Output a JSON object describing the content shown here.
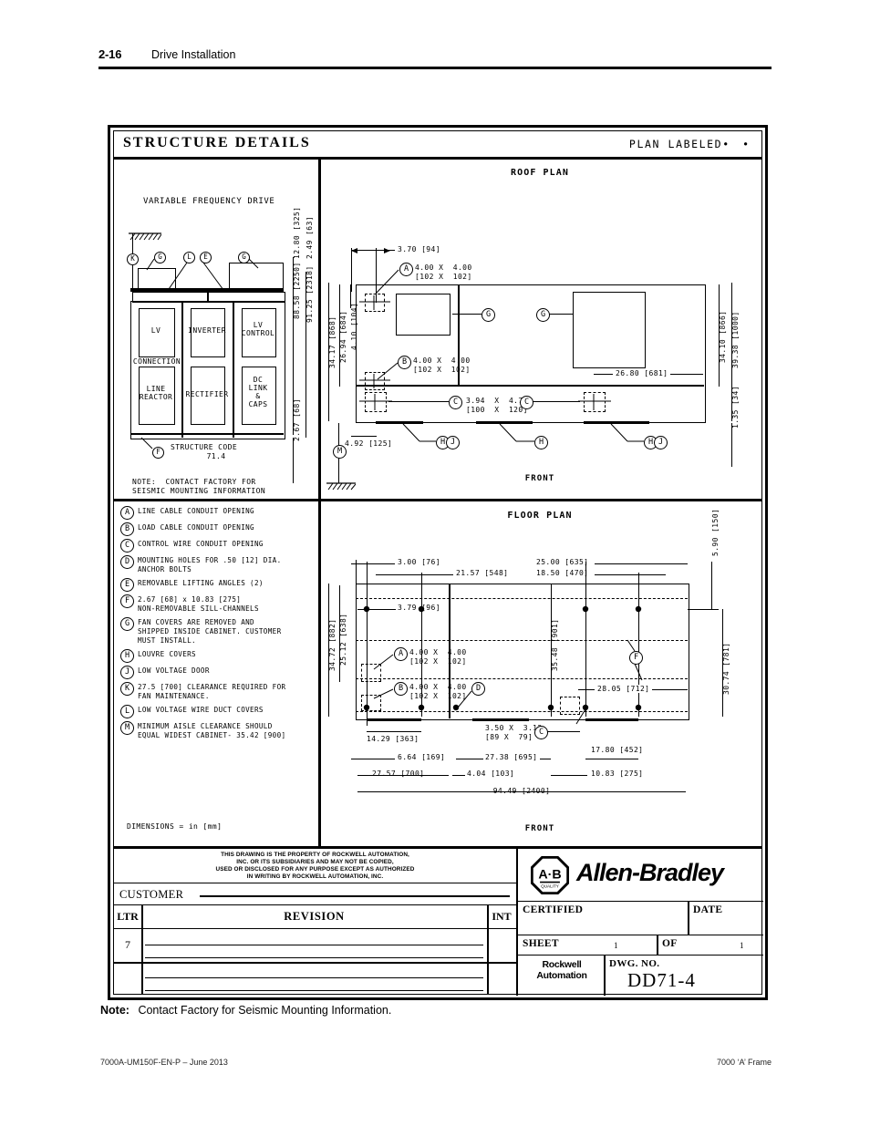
{
  "page_header": {
    "page_number": "2-16",
    "section_title": "Drive Installation"
  },
  "drawing": {
    "title": "STRUCTURE  DETAILS",
    "plan_labeled": "PLAN LABELED",
    "plan_labeled_dots": "•   •",
    "dimensions_note": "DIMENSIONS = in [mm]"
  },
  "elevation": {
    "caption": "VARIABLE FREQUENCY DRIVE",
    "structure_code_label": "STRUCTURE CODE",
    "structure_code_value": "71.4",
    "note_line1": "NOTE:  CONTACT FACTORY FOR",
    "note_line2": "SEISMIC MOUNTING INFORMATION",
    "compartments": [
      "LV",
      "INVERTER",
      "LV\nCONTROL",
      "CONNECTION",
      "LINE\nREACTOR",
      "RECTIFIER",
      "DC\nLINK\n&\nCAPS"
    ],
    "cell_lv": "LV",
    "cell_inverter": "INVERTER",
    "cell_lvcontrol": "LV\nCONTROL",
    "cell_connection": "CONNECTION",
    "cell_linereactor": "LINE\nREACTOR",
    "cell_rectifier": "RECTIFIER",
    "cell_dclink": "DC\nLINK\n&\nCAPS",
    "dims": {
      "d_12_80": "12.80 [325]",
      "d_2_49": "2.49 [63]",
      "d_88_58": "88.58 [2250]",
      "d_91_25": "91.25 [2318]",
      "d_2_67": "2.67 [68]"
    },
    "balloons": [
      "K",
      "G",
      "L",
      "E",
      "G",
      "F"
    ]
  },
  "roof_plan": {
    "title": "ROOF PLAN",
    "front_label": "FRONT",
    "dims": {
      "d_3_70": "3.70 [94]",
      "a_size": "4.00 X  4.00",
      "a_size_mm": "[102 X  102]",
      "b_size": "4.00 X  4.00",
      "b_size_mm": "[102 X  102]",
      "c_size": "3.94  X  4.73",
      "c_size_mm": "[100  X  120]",
      "d_34_17": "34.17 [868]",
      "d_26_94": "26.94 [684]",
      "d_4_10": "4.10 [104]",
      "d_4_92": "4.92 [125]",
      "d_26_80": "26.80 [681]",
      "d_34_10": "34.10 [866]",
      "d_39_38": "39.38 [1000]",
      "d_1_35": "1.35 [34]"
    },
    "balloons": [
      "A",
      "B",
      "C",
      "C",
      "G",
      "G",
      "H",
      "J",
      "H",
      "H",
      "J",
      "M"
    ]
  },
  "floor_plan": {
    "title": "FLOOR PLAN",
    "front_label": "FRONT",
    "dims": {
      "d_3_00": "3.00 [76]",
      "d_21_57": "21.57 [548]",
      "d_25_00": "25.00 [635]",
      "d_18_50": "18.50 [470]",
      "d_5_90": "5.90 [150]",
      "d_3_79": "3.79 [96]",
      "d_34_72": "34.72 [882]",
      "d_25_12": "25.12 [638]",
      "d_35_48": "35.48 [901]",
      "d_30_74": "30.74 [781]",
      "d_28_05": "28.05 [712]",
      "a_size": "4.00 X  4.00",
      "a_size_mm": "[102 X  102]",
      "b_size": "4.00 X  4.00",
      "b_size_mm": "[102 X  102]",
      "c_size": "3.50 X  3.12",
      "c_size_mm": "[89 X  79]",
      "d_14_29": "14.29 [363]",
      "d_6_64": "6.64 [169]",
      "d_27_38": "27.38 [695]",
      "d_17_80": "17.80 [452]",
      "d_27_57": "27.57 [700]",
      "d_4_04": "4.04 [103]",
      "d_10_83": "10.83 [275]",
      "d_94_49": "94.49 [2400]"
    },
    "balloons": [
      "A",
      "B",
      "C",
      "D",
      "F"
    ]
  },
  "legend": [
    {
      "letter": "A",
      "text": "LINE CABLE CONDUIT OPENING"
    },
    {
      "letter": "B",
      "text": "LOAD CABLE CONDUIT OPENING"
    },
    {
      "letter": "C",
      "text": "CONTROL WIRE CONDUIT OPENING"
    },
    {
      "letter": "D",
      "text": "MOUNTING HOLES FOR .50 [12] DIA.\nANCHOR BOLTS"
    },
    {
      "letter": "E",
      "text": "REMOVABLE LIFTING ANGLES (2)"
    },
    {
      "letter": "F",
      "text": "2.67 [68] x 10.83 [275]\nNON-REMOVABLE SILL-CHANNELS"
    },
    {
      "letter": "G",
      "text": "FAN COVERS ARE REMOVED AND\nSHIPPED INSIDE CABINET.  CUSTOMER\nMUST INSTALL."
    },
    {
      "letter": "H",
      "text": "LOUVRE COVERS"
    },
    {
      "letter": "J",
      "text": "LOW VOLTAGE DOOR"
    },
    {
      "letter": "K",
      "text": "27.5 [700] CLEARANCE REQUIRED FOR\nFAN MAINTENANCE."
    },
    {
      "letter": "L",
      "text": "LOW VOLTAGE WIRE DUCT COVERS"
    },
    {
      "letter": "M",
      "text": "MINIMUM AISLE CLEARANCE SHOULD\nEQUAL WIDEST CABINET- 35.42 [900]"
    }
  ],
  "title_block": {
    "property_notice": "THIS DRAWING IS THE PROPERTY OF ROCKWELL AUTOMATION,\nINC. OR ITS SUBSIDIARIES AND MAY NOT BE COPIED,\nUSED OR DISCLOSED FOR ANY PURPOSE EXCEPT AS AUTHORIZED\nIN WRITING BY ROCKWELL AUTOMATION, INC.",
    "customer_label": "CUSTOMER",
    "customer_value": "",
    "ltr_header": "LTR",
    "revision_header": "REVISION",
    "int_header": "INT",
    "revision_rows": [
      {
        "ltr": "7",
        "revision": "",
        "int": ""
      },
      {
        "ltr": "",
        "revision": "",
        "int": ""
      },
      {
        "ltr": "",
        "revision": "",
        "int": ""
      },
      {
        "ltr": "",
        "revision": "",
        "int": ""
      }
    ],
    "brand_name": "Allen-Bradley",
    "brand_mark": "A·B",
    "brand_mark_sub": "QUALITY",
    "certified_label": "CERTIFIED",
    "certified_value": "",
    "date_label": "DATE",
    "date_value": "",
    "sheet_label": "SHEET",
    "sheet_value": "1",
    "of_label": "OF",
    "of_value": "1",
    "ra_logo_line1": "Rockwell",
    "ra_logo_line2": "Automation",
    "dwg_no_label": "DWG. NO.",
    "dwg_no_value": "DD71-4"
  },
  "note": {
    "label": "Note:",
    "text": "Contact Factory for Seismic Mounting Information."
  },
  "footer": {
    "left": "7000A-UM150F-EN-P – June 2013",
    "right": "7000 ‘A’ Frame"
  }
}
